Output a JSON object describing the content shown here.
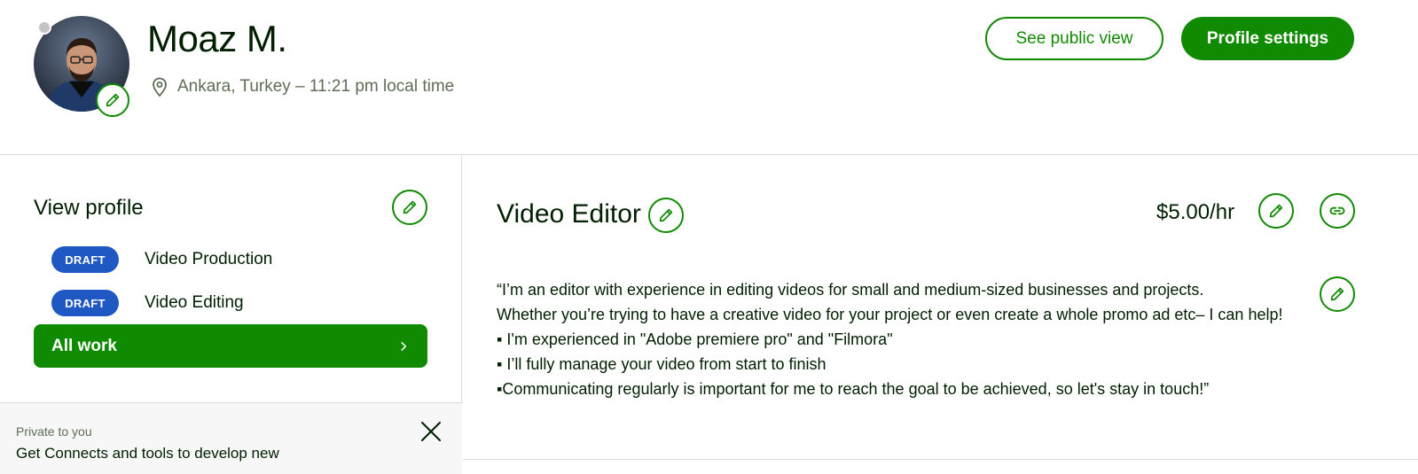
{
  "profile": {
    "name": "Moaz M.",
    "location": "Ankara, Turkey – 11:21 pm local time"
  },
  "actions": {
    "public_view_label": "See public view",
    "settings_label": "Profile settings"
  },
  "sidebar": {
    "title": "View profile",
    "specialized": [
      {
        "badge": "DRAFT",
        "label": "Video Production"
      },
      {
        "badge": "DRAFT",
        "label": "Video Editing"
      }
    ],
    "all_work_label": "All work",
    "private_label": "Private to you",
    "private_text": "Get Connects and tools to develop new"
  },
  "main": {
    "title": "Video Editor",
    "rate": "$5.00/hr",
    "description": [
      "“I’m an editor with experience in editing videos for small and medium-sized businesses and projects.",
      "Whether you’re trying to have a creative video for your project or even create a whole promo ad etc– I can help!",
      "▪ I'm experienced in \"Adobe premiere pro\" and \"Filmora\"",
      "▪ I’ll fully manage your video from start to finish",
      "▪Communicating regularly is important for me to reach the goal to be achieved, so let's stay in touch!”"
    ]
  },
  "colors": {
    "brand_green": "#108a00",
    "draft_blue": "#1f57c3",
    "text_dark": "#001e00",
    "text_muted": "#5e6d55"
  },
  "icons": [
    "pencil-icon",
    "location-pin-icon",
    "chevron-right-icon",
    "link-icon",
    "close-icon"
  ]
}
